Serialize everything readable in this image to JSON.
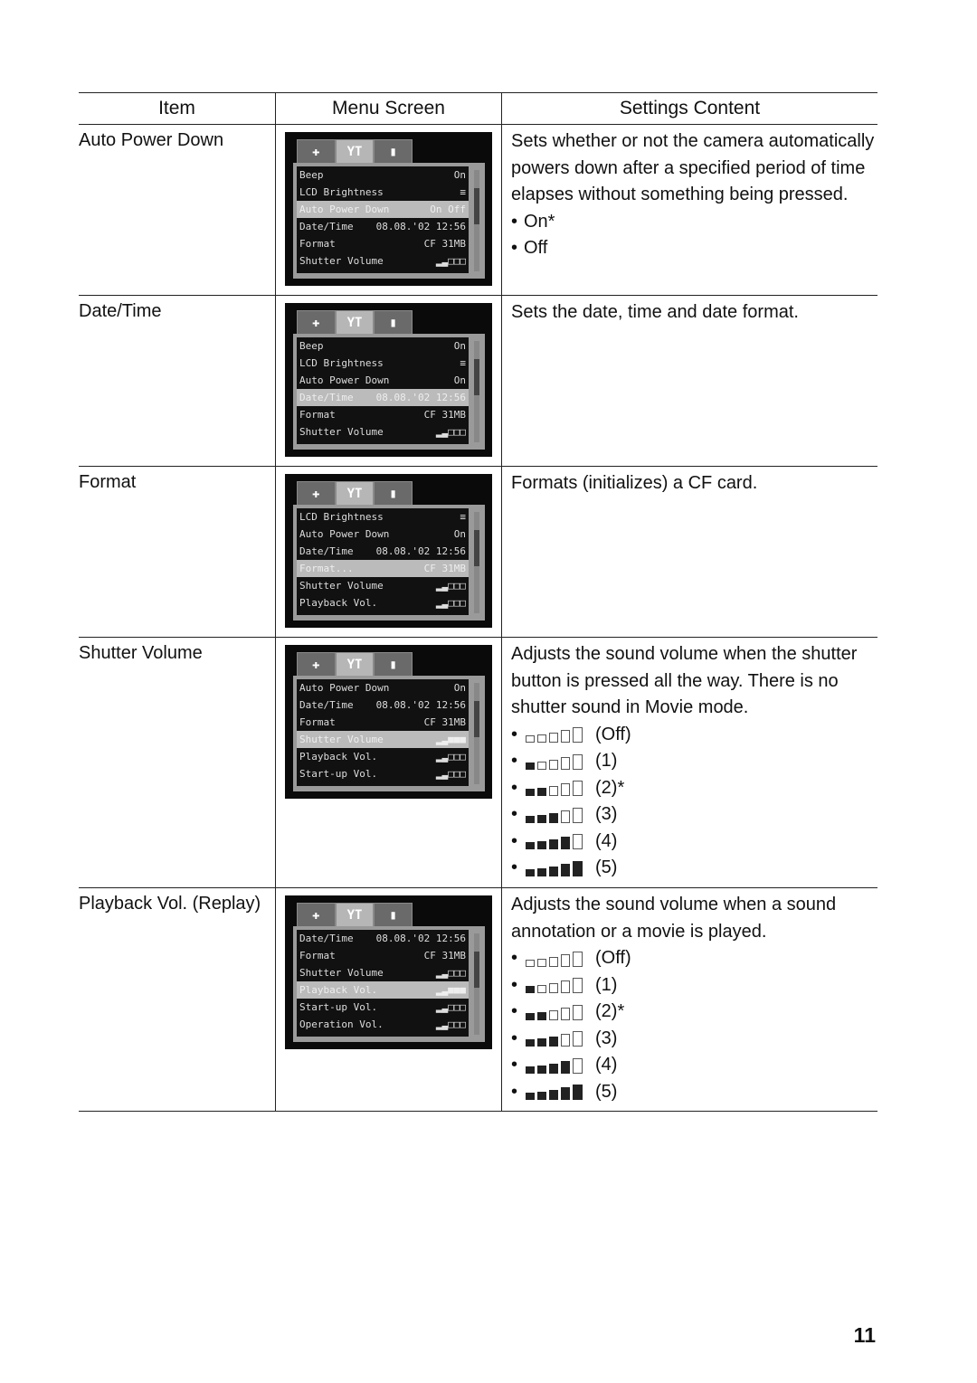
{
  "table": {
    "headers": [
      "Item",
      "Menu Screen",
      "Settings Content"
    ],
    "rows": [
      {
        "item": "Auto Power Down",
        "menu": [
          [
            "Beep",
            "On"
          ],
          [
            "LCD Brightness",
            "≡"
          ],
          [
            "Auto Power Down",
            "On  Off"
          ],
          [
            "Date/Time",
            "08.08.'02 12:56"
          ],
          [
            "Format",
            "CF  31MB"
          ],
          [
            "Shutter Volume",
            "▂▃□□□"
          ]
        ],
        "selected": 2,
        "desc": [
          "Sets whether or not the camera automatically powers down after a specified period of time elapses without something being pressed."
        ],
        "options": [
          "On*",
          "Off"
        ]
      },
      {
        "item": "Date/Time",
        "menu": [
          [
            "Beep",
            "On"
          ],
          [
            "LCD Brightness",
            "≡"
          ],
          [
            "Auto Power Down",
            "On"
          ],
          [
            "Date/Time",
            "08.08.'02 12:56"
          ],
          [
            "Format",
            "CF  31MB"
          ],
          [
            "Shutter Volume",
            "▂▃□□□"
          ]
        ],
        "selected": 3,
        "desc": [
          "Sets the date, time and date format."
        ],
        "options": []
      },
      {
        "item": "Format",
        "menu": [
          [
            "LCD Brightness",
            "≡"
          ],
          [
            "Auto Power Down",
            "On"
          ],
          [
            "Date/Time",
            "08.08.'02 12:56"
          ],
          [
            "Format...",
            "CF  31MB"
          ],
          [
            "Shutter Volume",
            "▂▃□□□"
          ],
          [
            "Playback Vol.",
            "▂▃□□□"
          ]
        ],
        "selected": 3,
        "desc": [
          "Formats (initializes) a CF card."
        ],
        "options": []
      },
      {
        "item": "Shutter Volume",
        "menu": [
          [
            "Auto Power Down",
            "On"
          ],
          [
            "Date/Time",
            "08.08.'02 12:56"
          ],
          [
            "Format",
            "CF  31MB"
          ],
          [
            "Shutter Volume",
            "▂▃■■■"
          ],
          [
            "Playback Vol.",
            "▂▃□□□"
          ],
          [
            "Start-up Vol.",
            "▂▃□□□"
          ]
        ],
        "selected": 3,
        "desc": [
          "Adjusts the sound volume when the shutter button is pressed all the way. There is no shutter sound in Movie mode."
        ],
        "volume_options": [
          {
            "level": 0,
            "label": "(Off)"
          },
          {
            "level": 1,
            "label": "(1)"
          },
          {
            "level": 2,
            "label": "(2)*"
          },
          {
            "level": 3,
            "label": "(3)"
          },
          {
            "level": 4,
            "label": "(4)"
          },
          {
            "level": 5,
            "label": "(5)"
          }
        ]
      },
      {
        "item": "Playback Vol. (Replay)",
        "menu": [
          [
            "Date/Time",
            "08.08.'02 12:56"
          ],
          [
            "Format",
            "CF  31MB"
          ],
          [
            "Shutter Volume",
            "▂▃□□□"
          ],
          [
            "Playback Vol.",
            "▂▃■■■"
          ],
          [
            "Start-up Vol.",
            "▂▃□□□"
          ],
          [
            "Operation Vol.",
            "▂▃□□□"
          ]
        ],
        "selected": 3,
        "desc": [
          "Adjusts the sound volume when a sound annotation or a movie is played."
        ],
        "volume_options": [
          {
            "level": 0,
            "label": "(Off)"
          },
          {
            "level": 1,
            "label": "(1)"
          },
          {
            "level": 2,
            "label": "(2)*"
          },
          {
            "level": 3,
            "label": "(3)"
          },
          {
            "level": 4,
            "label": "(4)"
          },
          {
            "level": 5,
            "label": "(5)"
          }
        ]
      }
    ]
  },
  "lcd_tabs": [
    "✚",
    "YT",
    "▮"
  ],
  "bullet": "•",
  "page_number": "11"
}
